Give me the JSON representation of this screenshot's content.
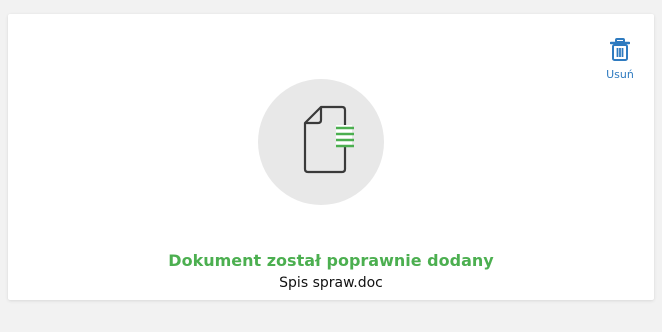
{
  "card": {
    "delete": {
      "label": "Usuń",
      "icon": "trash-icon"
    },
    "document_icon": "document-icon",
    "status_message": "Dokument został poprawnie dodany",
    "file_name": "Spis spraw.doc"
  },
  "colors": {
    "success": "#4caf50",
    "link": "#2f7bc0",
    "icon_bg": "#e8e8e8",
    "icon_stroke": "#3a3a3a"
  }
}
